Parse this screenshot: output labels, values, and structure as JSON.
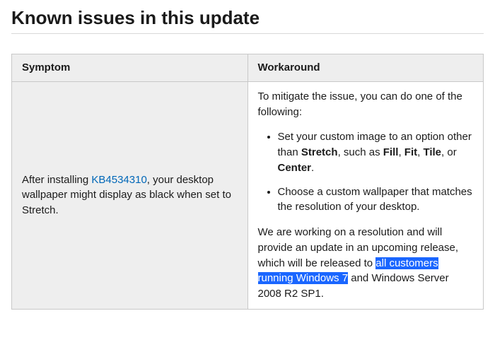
{
  "heading": "Known issues in this update",
  "table": {
    "headers": {
      "symptom": "Symptom",
      "workaround": "Workaround"
    },
    "row": {
      "symptom": {
        "pre": "After installing ",
        "kb": "KB4534310",
        "post": ", your desktop wallpaper might display as black when set to Stretch."
      },
      "workaround": {
        "intro": "To mitigate the issue, you can do one of the following:",
        "bullets": {
          "b1": {
            "t1": "Set your custom image to an option other than ",
            "stretch": "Stretch",
            "t2": ", such as ",
            "fill": "Fill",
            "t3": ", ",
            "fit": "Fit",
            "t4": ", ",
            "tile": "Tile",
            "t5": ", or ",
            "center": "Center",
            "t6": "."
          },
          "b2": "Choose a custom wallpaper that matches the resolution of your desktop."
        },
        "footer": {
          "t1": "We are working on a resolution and will provide an update in an upcoming release, which will be released to ",
          "highlight": "all customers running Windows 7",
          "t2": " and Windows Server 2008 R2 SP1."
        }
      }
    }
  }
}
